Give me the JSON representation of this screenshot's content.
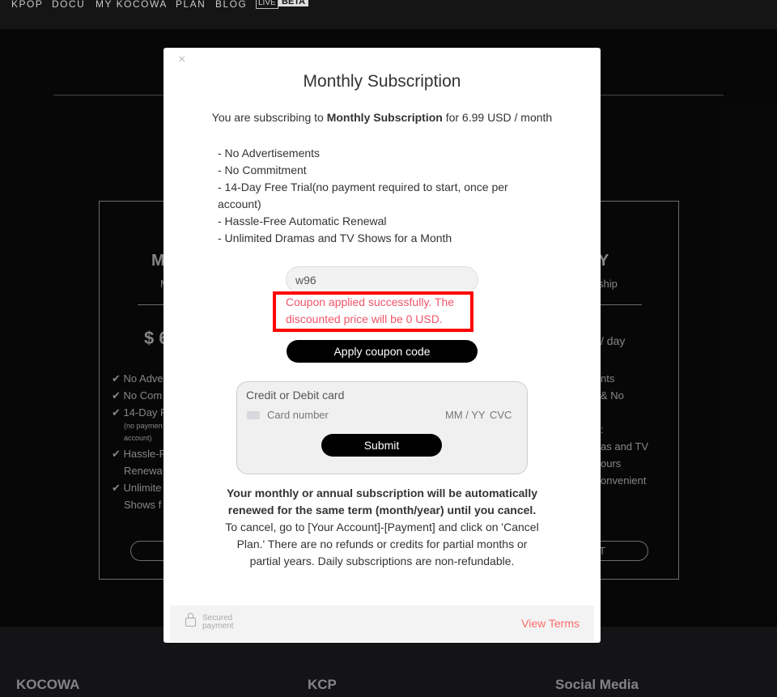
{
  "nav": {
    "items": [
      "KPOP",
      "DOCU",
      "MY KOCOWA",
      "PLAN",
      "BLOG"
    ],
    "live": "LIVE",
    "beta": "BETA"
  },
  "plans": {
    "left": {
      "title": "M",
      "subtitle": "M",
      "price": "$ 6",
      "features": [
        "No Adve",
        "No Com",
        "14-Day F",
        "Hassle-F",
        "Unlimite"
      ],
      "sub_note1": "(no paymen",
      "sub_note2": "account)",
      "cont1": "Renewa",
      "cont2": "Shows f"
    },
    "right": {
      "title": "Y",
      "subtitle": "ship",
      "price": "/ day",
      "lines": [
        "nts",
        "& No",
        ":",
        "as and TV",
        "ours",
        "onvenient"
      ],
      "button": "T"
    }
  },
  "modal": {
    "title": "Monthly Subscription",
    "intro_pre": "You are subscribing to ",
    "intro_bold": "Monthly Subscription",
    "intro_post": " for 6.99 USD / month",
    "features": [
      "- No Advertisements",
      "- No Commitment",
      "- 14-Day Free Trial(no payment required to start, once per account)",
      "- Hassle-Free Automatic Renewal",
      "- Unlimited Dramas and TV Shows for a Month"
    ],
    "coupon_value": "w96",
    "coupon_message": "Coupon applied successfully. The discounted price will be 0 USD.",
    "apply_label": "Apply coupon code",
    "card_title": "Credit or Debit card",
    "card_number_placeholder": "Card number",
    "expiry_placeholder": "MM / YY",
    "cvc_placeholder": "CVC",
    "submit_label": "Submit",
    "notice_bold": "Your monthly or annual subscription will be automatically renewed for the same term (month/year) until you cancel.",
    "notice_rest": "  To cancel, go to [Your Account]-[Payment] and click on 'Cancel Plan.' There are no refunds or credits for partial months or partial years. Daily subscriptions are non-refundable.",
    "secured_line1": "Secured",
    "secured_line2": "payment",
    "view_terms": "View Terms",
    "close_icon": "×"
  },
  "footer": {
    "cols": [
      "KOCOWA",
      "KCP",
      "Social Media"
    ]
  },
  "colors": {
    "highlight": "#ff0000",
    "error_text": "#f0556a",
    "link": "#ff6b6b"
  }
}
